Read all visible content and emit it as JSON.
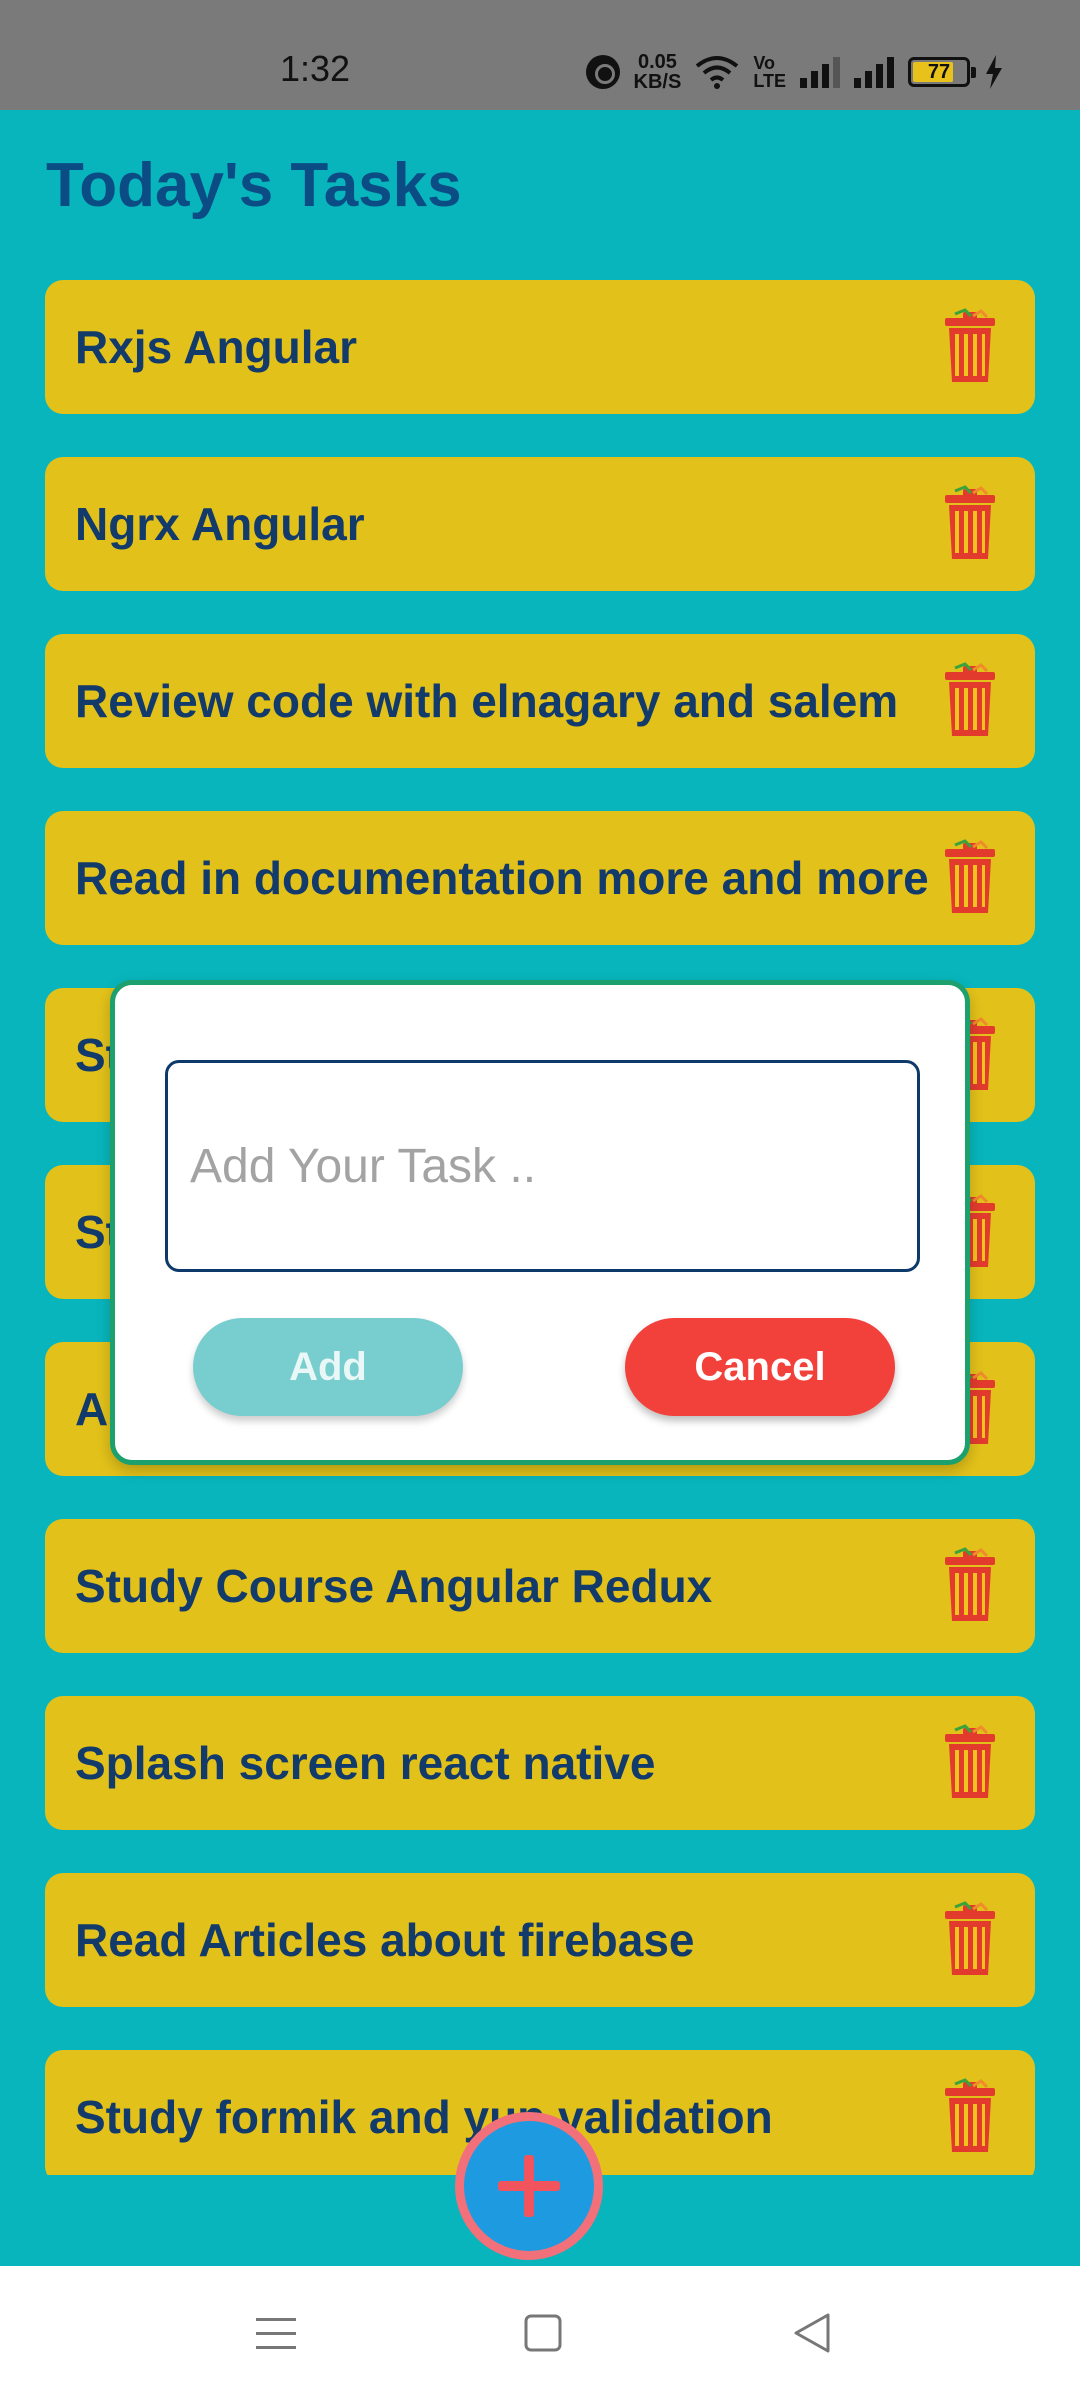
{
  "status_bar": {
    "time": "1:32",
    "net_speed_value": "0.05",
    "net_speed_unit": "KB/S",
    "volte_top": "Vo",
    "volte_bottom": "LTE",
    "battery_level": "77"
  },
  "page": {
    "title": "Today's Tasks"
  },
  "tasks": [
    {
      "label": "Rxjs Angular"
    },
    {
      "label": "Ngrx Angular"
    },
    {
      "label": "Review code with elnagary and salem"
    },
    {
      "label": "Read in documentation more and more"
    },
    {
      "label": "St"
    },
    {
      "label": "St"
    },
    {
      "label": "A"
    },
    {
      "label": "Study Course Angular Redux"
    },
    {
      "label": "Splash screen react native"
    },
    {
      "label": "Read Articles about firebase"
    },
    {
      "label": "Study formik and yup validation"
    }
  ],
  "dialog": {
    "input_placeholder": "Add Your Task ..",
    "input_value": "",
    "add_label": "Add",
    "cancel_label": "Cancel"
  },
  "icons": {
    "task_delete": "trash-icon",
    "fab": "plus-icon",
    "nav": [
      "menu-icon",
      "home-square-icon",
      "back-triangle-icon"
    ]
  },
  "colors": {
    "background": "#08B5BC",
    "task_card": "#E2C11A",
    "title": "#0B4C85",
    "task_text": "#123A6A",
    "cancel": "#F2413A",
    "add_disabled": "#78CDCF",
    "fab": "#1E9BE0",
    "fab_border": "#F2707A",
    "dialog_border": "#1BA06E"
  }
}
